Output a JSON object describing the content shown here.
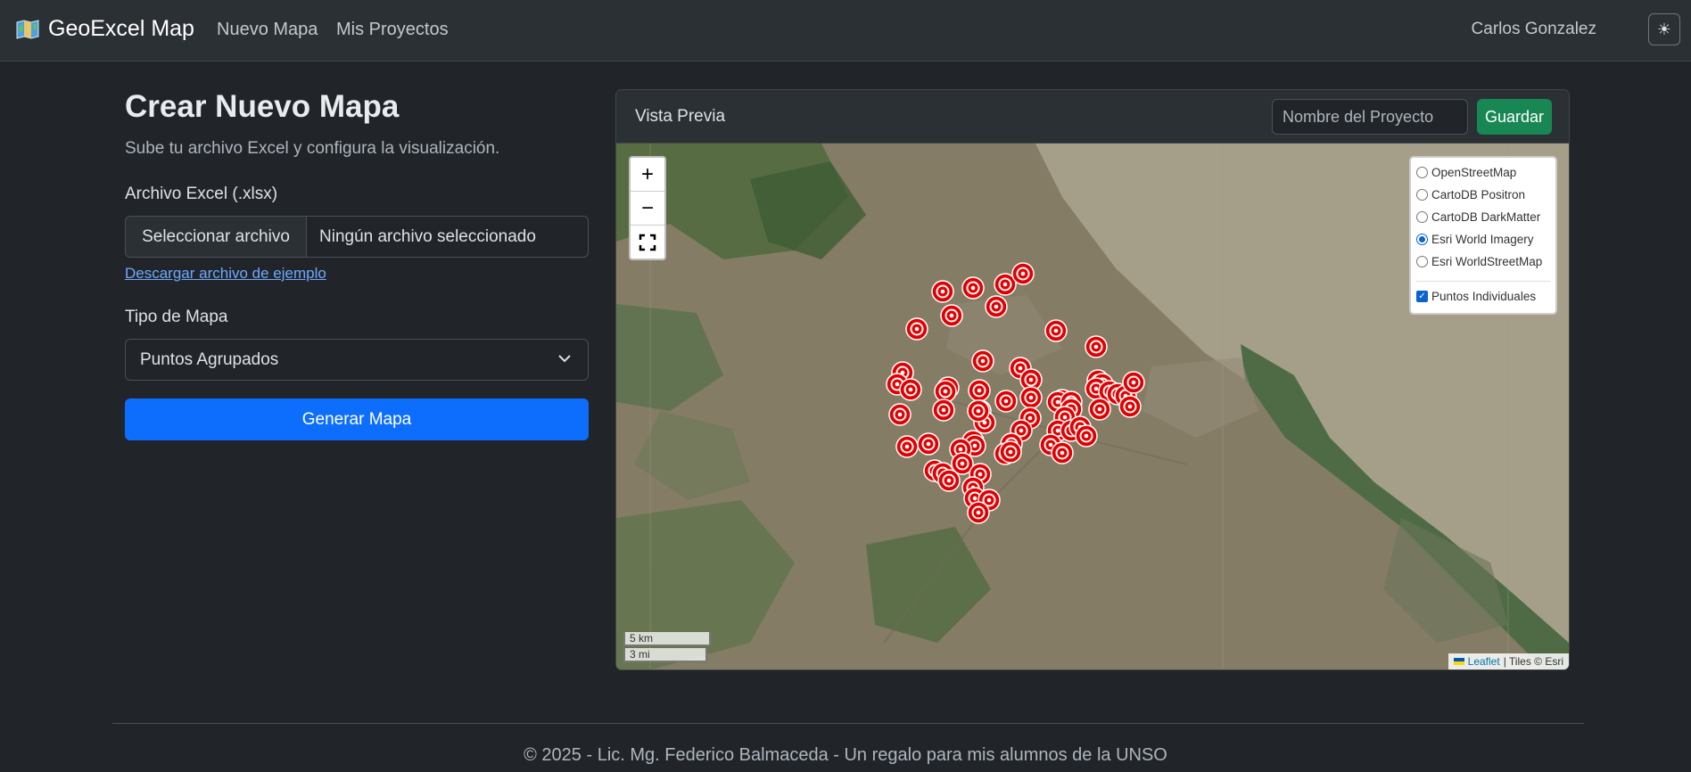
{
  "navbar": {
    "brand": "GeoExcel Map",
    "brand_icon": "map-icon",
    "links": [
      "Nuevo Mapa",
      "Mis Proyectos"
    ],
    "user": "Carlos Gonzalez",
    "theme_icon": "sun-icon"
  },
  "form": {
    "title": "Crear Nuevo Mapa",
    "subtitle": "Sube tu archivo Excel y configura la visualización.",
    "file_label": "Archivo Excel (.xlsx)",
    "file_button": "Seleccionar archivo",
    "file_status": "Ningún archivo seleccionado",
    "sample_link": "Descargar archivo de ejemplo",
    "map_type_label": "Tipo de Mapa",
    "map_type_value": "Puntos Agrupados",
    "generate_button": "Generar Mapa"
  },
  "preview": {
    "title": "Vista Previa",
    "project_placeholder": "Nombre del Proyecto",
    "save_button": "Guardar",
    "zoom_in": "+",
    "zoom_out": "−",
    "layers": {
      "base": [
        {
          "label": "OpenStreetMap",
          "selected": false
        },
        {
          "label": "CartoDB Positron",
          "selected": false
        },
        {
          "label": "CartoDB DarkMatter",
          "selected": false
        },
        {
          "label": "Esri World Imagery",
          "selected": true
        },
        {
          "label": "Esri WorldStreetMap",
          "selected": false
        }
      ],
      "overlay": {
        "label": "Puntos Individuales",
        "checked": true
      }
    },
    "scale_km": "5 km",
    "scale_mi": "3 mi",
    "attribution_link": "Leaflet",
    "attribution_text": "| Tiles © Esri",
    "marker_color": "#e30000"
  },
  "footer": {
    "text": "© 2025 - Lic. Mg. Federico Balmaceda - Un regalo para mis alumnos de la UNSO"
  }
}
